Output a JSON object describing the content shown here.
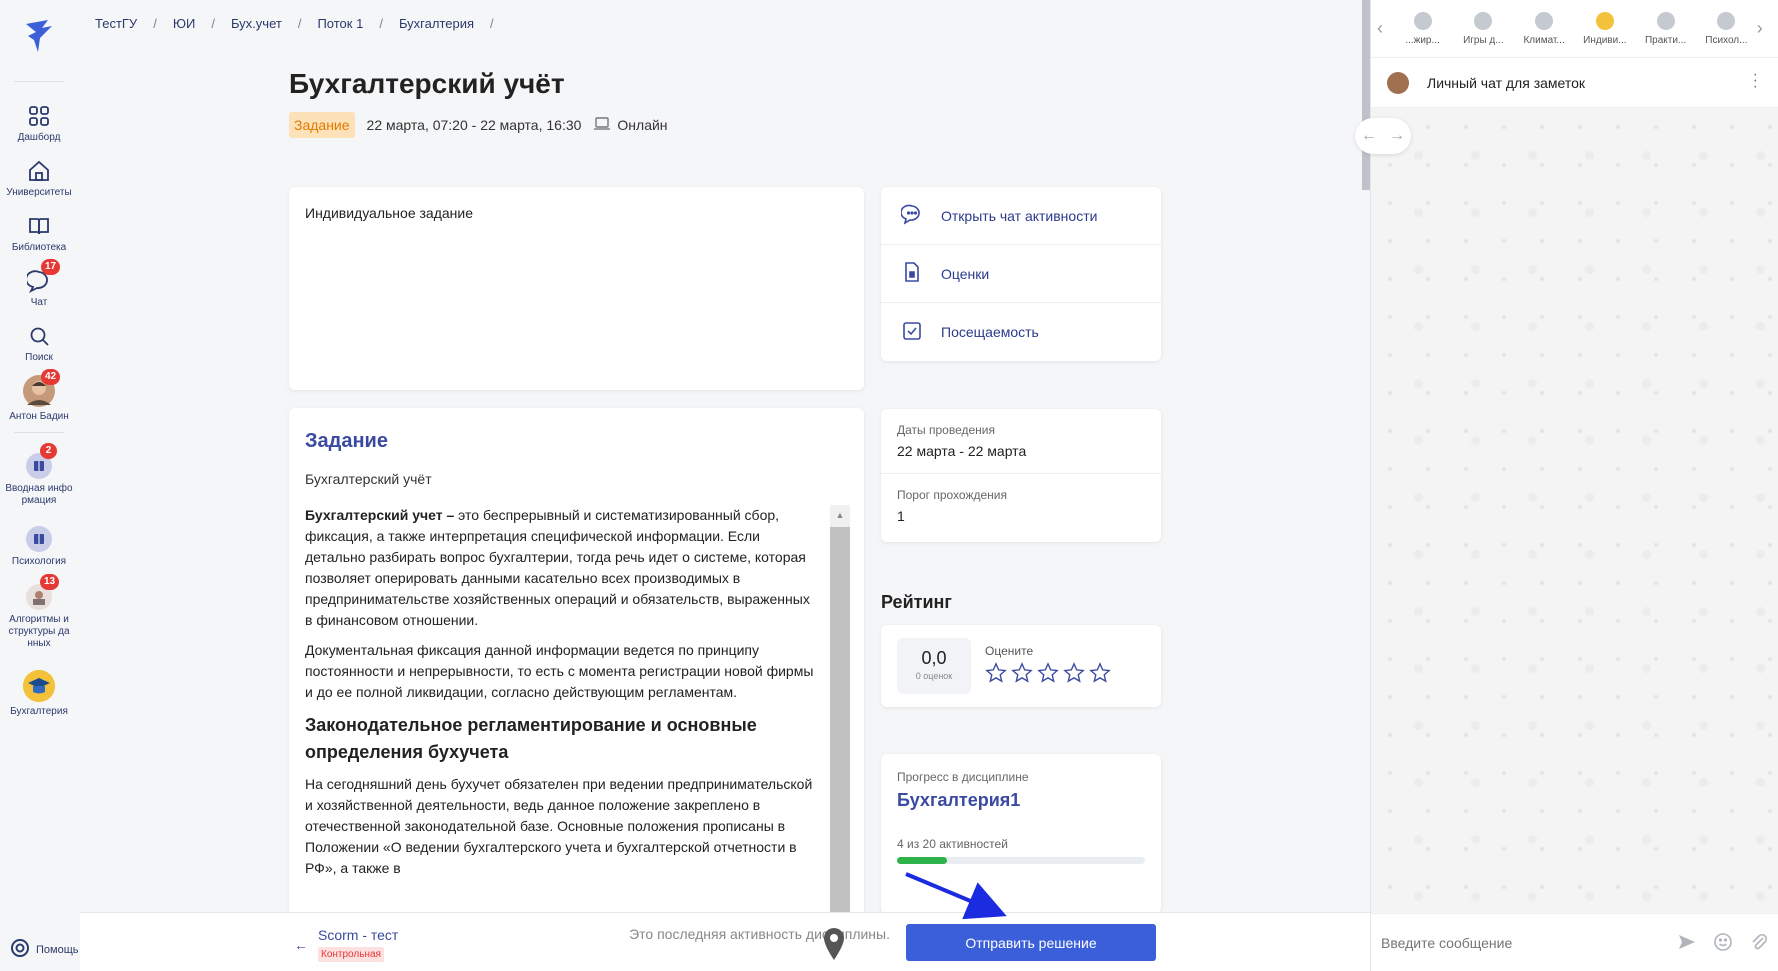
{
  "sidebar": {
    "items": [
      {
        "label": "Дашборд"
      },
      {
        "label": "Университеты"
      },
      {
        "label": "Библиотека"
      },
      {
        "label": "Чат",
        "badge": "17"
      },
      {
        "label": "Поиск"
      },
      {
        "label": "Антон Бадин",
        "badge": "42"
      }
    ],
    "courses": [
      {
        "label": "Вводная инфо рмация",
        "badge": "2"
      },
      {
        "label": "Психология"
      },
      {
        "label": "Алгоритмы и структуры да нных",
        "badge": "13"
      },
      {
        "label": "Бухгалтерия"
      }
    ],
    "help_label": "Помощь"
  },
  "breadcrumb": [
    "ТестГУ",
    "ЮИ",
    "Бух.учет",
    "Поток 1",
    "Бухгалтерия"
  ],
  "page": {
    "title": "Бухгалтерский учёт",
    "tag": "Задание",
    "datetime": "22 марта, 07:20 - 22 марта, 16:30",
    "mode": "Онлайн"
  },
  "description": "Индивидуальное задание",
  "actions": [
    {
      "label": "Открыть чат активности",
      "icon": "chat-bubble-icon"
    },
    {
      "label": "Оценки",
      "icon": "grades-icon"
    },
    {
      "label": "Посещаемость",
      "icon": "checkbox-icon"
    }
  ],
  "task": {
    "heading": "Задание",
    "subtitle": "Бухгалтерский учёт",
    "p1_bold": "Бухгалтерский учет –",
    "p1_rest": " это беспрерывный и систематизированный сбор, фиксация, а также интерпретация специфической информации. Если детально разбирать вопрос бухгалтерии, тогда речь идет о системе, которая позволяет оперировать данными касательно всех производимых в предпринимательстве хозяйственных операций и обязательств, выраженных в финансовом отношении.",
    "p2": "Документальная фиксация данной информации ведется по принципу постоянности и непрерывности, то есть с момента регистрации новой фирмы и до ее полной ликвидации, согласно действующим регламентам.",
    "h3": "Законодательное регламентирование и основные определения бухучета",
    "p3": "На сегодняшний день бухучет обязателен при ведении предпринимательской и хозяйственной деятельности, ведь данное положение закреплено в отечественной законодательной базе. Основные положения прописаны в Положении «О ведении бухгалтерского учета и бухгалтерской отчетности в РФ», а также в"
  },
  "dates": {
    "label1": "Даты проведения",
    "value1": "22 марта - 22 марта",
    "label2": "Порог прохождения",
    "value2": "1"
  },
  "rating": {
    "title": "Рейтинг",
    "score": "0,0",
    "count": "0 оценок",
    "rate_label": "Оцените",
    "stars_filled": 0,
    "stars_total": 5
  },
  "progress": {
    "label": "Прогресс в дисциплине",
    "name": "Бухгалтерия1",
    "count_text": "4 из 20 активностей",
    "fraction": 0.2
  },
  "bottom": {
    "prev_title": "Scorm - тест",
    "prev_tag": "Контрольная",
    "last_note": "Это последняя активность дисциплины.",
    "submit": "Отправить решение"
  },
  "chat": {
    "tabs": [
      "...жир...",
      "Игры д...",
      "Климат...",
      "Индиви...",
      "Практи...",
      "Психол..."
    ],
    "title": "Личный чат для заметок",
    "input_placeholder": "Введите сообщение"
  },
  "colors": {
    "accent": "#3a5fd8",
    "link": "#2b3a8c",
    "badge": "#e53935",
    "tag_bg": "#fde1b8",
    "tag_text": "#e07b00",
    "progress": "#2db34a"
  }
}
